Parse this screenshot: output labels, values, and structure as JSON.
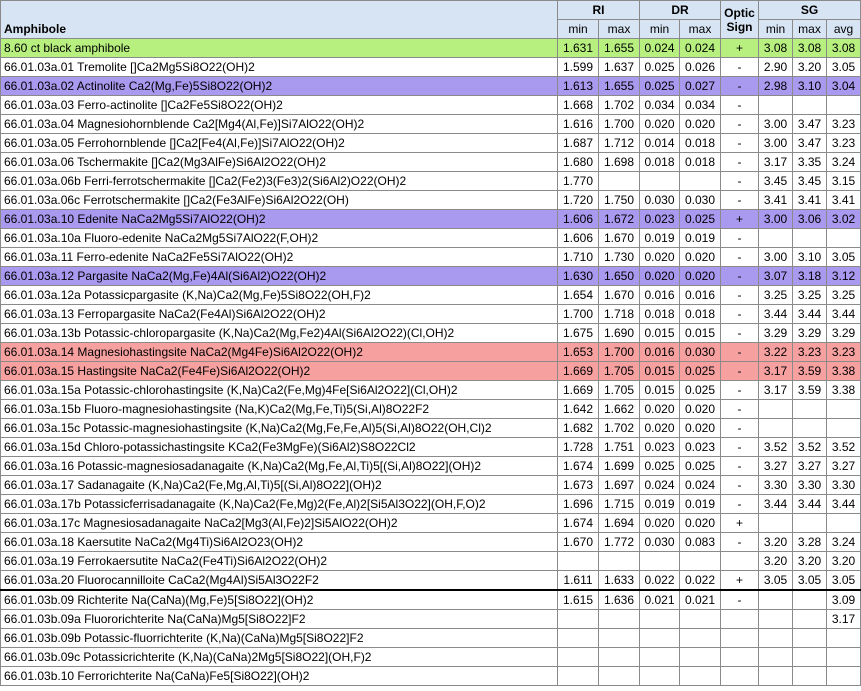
{
  "header": {
    "name_label": "Amphibole",
    "ri_label": "RI",
    "dr_label": "DR",
    "optic_sign_label": "Optic Sign",
    "sg_label": "SG",
    "min_label": "min",
    "max_label": "max",
    "avg_label": "avg"
  },
  "colors": {
    "header_bg": "#d7e4f3",
    "sample_highlight": "#b7f07f",
    "purple_highlight": "#a99af0",
    "red_highlight": "#f7a0a0"
  },
  "rows": [
    {
      "name": "8.60 ct black amphibole",
      "ri_min": "1.631",
      "ri_max": "1.655",
      "dr_min": "0.024",
      "dr_max": "0.024",
      "sign": "+",
      "sg_min": "3.08",
      "sg_max": "3.08",
      "sg_avg": "3.08",
      "hl": "sample"
    },
    {
      "name": "66.01.03a.01 Tremolite []Ca2Mg5Si8O22(OH)2",
      "ri_min": "1.599",
      "ri_max": "1.637",
      "dr_min": "0.025",
      "dr_max": "0.026",
      "sign": "-",
      "sg_min": "2.90",
      "sg_max": "3.20",
      "sg_avg": "3.05",
      "hl": ""
    },
    {
      "name": "66.01.03a.02 Actinolite Ca2(Mg,Fe)5Si8O22(OH)2",
      "ri_min": "1.613",
      "ri_max": "1.655",
      "dr_min": "0.025",
      "dr_max": "0.027",
      "sign": "-",
      "sg_min": "2.98",
      "sg_max": "3.10",
      "sg_avg": "3.04",
      "hl": "purple"
    },
    {
      "name": "66.01.03a.03 Ferro-actinolite []Ca2Fe5Si8O22(OH)2",
      "ri_min": "1.668",
      "ri_max": "1.702",
      "dr_min": "0.034",
      "dr_max": "0.034",
      "sign": "-",
      "sg_min": "",
      "sg_max": "",
      "sg_avg": "",
      "hl": ""
    },
    {
      "name": "66.01.03a.04 Magnesiohornblende Ca2[Mg4(Al,Fe)]Si7AlO22(OH)2",
      "ri_min": "1.616",
      "ri_max": "1.700",
      "dr_min": "0.020",
      "dr_max": "0.020",
      "sign": "-",
      "sg_min": "3.00",
      "sg_max": "3.47",
      "sg_avg": "3.23",
      "hl": ""
    },
    {
      "name": "66.01.03a.05 Ferrohornblende []Ca2[Fe4(Al,Fe)]Si7AlO22(OH)2",
      "ri_min": "1.687",
      "ri_max": "1.712",
      "dr_min": "0.014",
      "dr_max": "0.018",
      "sign": "-",
      "sg_min": "3.00",
      "sg_max": "3.47",
      "sg_avg": "3.23",
      "hl": ""
    },
    {
      "name": "66.01.03a.06 Tschermakite []Ca2(Mg3AlFe)Si6Al2O22(OH)2",
      "ri_min": "1.680",
      "ri_max": "1.698",
      "dr_min": "0.018",
      "dr_max": "0.018",
      "sign": "-",
      "sg_min": "3.17",
      "sg_max": "3.35",
      "sg_avg": "3.24",
      "hl": ""
    },
    {
      "name": "66.01.03a.06b Ferri-ferrotschermakite  []Ca2(Fe2)3(Fe3)2(Si6Al2)O22(OH)2",
      "ri_min": "1.770",
      "ri_max": "",
      "dr_min": "",
      "dr_max": "",
      "sign": "-",
      "sg_min": "3.45",
      "sg_max": "3.45",
      "sg_avg": "3.15",
      "hl": ""
    },
    {
      "name": "66.01.03a.06c Ferrotschermakite  []Ca2(Fe3AlFe)Si6Al2O22(OH)",
      "ri_min": "1.720",
      "ri_max": "1.750",
      "dr_min": "0.030",
      "dr_max": "0.030",
      "sign": "-",
      "sg_min": "3.41",
      "sg_max": "3.41",
      "sg_avg": "3.41",
      "hl": ""
    },
    {
      "name": "66.01.03a.10 Edenite NaCa2Mg5Si7AlO22(OH)2",
      "ri_min": "1.606",
      "ri_max": "1.672",
      "dr_min": "0.023",
      "dr_max": "0.025",
      "sign": "+",
      "sg_min": "3.00",
      "sg_max": "3.06",
      "sg_avg": "3.02",
      "hl": "purple"
    },
    {
      "name": "66.01.03a.10a Fluoro-edenite  NaCa2Mg5Si7AlO22(F,OH)2",
      "ri_min": "1.606",
      "ri_max": "1.670",
      "dr_min": "0.019",
      "dr_max": "0.019",
      "sign": "-",
      "sg_min": "",
      "sg_max": "",
      "sg_avg": "",
      "hl": ""
    },
    {
      "name": "66.01.03a.11 Ferro-edenite NaCa2Fe5Si7AlO22(OH)2",
      "ri_min": "1.710",
      "ri_max": "1.730",
      "dr_min": "0.020",
      "dr_max": "0.020",
      "sign": "-",
      "sg_min": "3.00",
      "sg_max": "3.10",
      "sg_avg": "3.05",
      "hl": ""
    },
    {
      "name": "66.01.03a.12 Pargasite NaCa2(Mg,Fe)4Al(Si6Al2)O22(OH)2",
      "ri_min": "1.630",
      "ri_max": "1.650",
      "dr_min": "0.020",
      "dr_max": "0.020",
      "sign": "-",
      "sg_min": "3.07",
      "sg_max": "3.18",
      "sg_avg": "3.12",
      "hl": "purple"
    },
    {
      "name": "66.01.03a.12a Potassicpargasite  (K,Na)Ca2(Mg,Fe)5Si8O22(OH,F)2",
      "ri_min": "1.654",
      "ri_max": "1.670",
      "dr_min": "0.016",
      "dr_max": "0.016",
      "sign": "-",
      "sg_min": "3.25",
      "sg_max": "3.25",
      "sg_avg": "3.25",
      "hl": ""
    },
    {
      "name": "66.01.03a.13 Ferropargasite NaCa2(Fe4Al)Si6Al2O22(OH)2",
      "ri_min": "1.700",
      "ri_max": "1.718",
      "dr_min": "0.018",
      "dr_max": "0.018",
      "sign": "-",
      "sg_min": "3.44",
      "sg_max": "3.44",
      "sg_avg": "3.44",
      "hl": ""
    },
    {
      "name": "66.01.03a.13b Potassic-chloropargasite  (K,Na)Ca2(Mg,Fe2)4Al(Si6Al2O22)(Cl,OH)2",
      "ri_min": "1.675",
      "ri_max": "1.690",
      "dr_min": "0.015",
      "dr_max": "0.015",
      "sign": "-",
      "sg_min": "3.29",
      "sg_max": "3.29",
      "sg_avg": "3.29",
      "hl": ""
    },
    {
      "name": "66.01.03a.14 Magnesiohastingsite NaCa2(Mg4Fe)Si6Al2O22(OH)2",
      "ri_min": "1.653",
      "ri_max": "1.700",
      "dr_min": "0.016",
      "dr_max": "0.030",
      "sign": "-",
      "sg_min": "3.22",
      "sg_max": "3.23",
      "sg_avg": "3.23",
      "hl": "red"
    },
    {
      "name": "66.01.03a.15 Hastingsite NaCa2(Fe4Fe)Si6Al2O22(OH)2",
      "ri_min": "1.669",
      "ri_max": "1.705",
      "dr_min": "0.015",
      "dr_max": "0.025",
      "sign": "-",
      "sg_min": "3.17",
      "sg_max": "3.59",
      "sg_avg": "3.38",
      "hl": "red"
    },
    {
      "name": "66.01.03a.15a Potassic-chlorohastingsite  (K,Na)Ca2(Fe,Mg)4Fe[Si6Al2O22](Cl,OH)2",
      "ri_min": "1.669",
      "ri_max": "1.705",
      "dr_min": "0.015",
      "dr_max": "0.025",
      "sign": "-",
      "sg_min": "3.17",
      "sg_max": "3.59",
      "sg_avg": "3.38",
      "hl": ""
    },
    {
      "name": "66.01.03a.15b Fluoro-magnesiohastingsite  (Na,K)Ca2(Mg,Fe,Ti)5(Si,Al)8O22F2",
      "ri_min": "1.642",
      "ri_max": "1.662",
      "dr_min": "0.020",
      "dr_max": "0.020",
      "sign": "-",
      "sg_min": "",
      "sg_max": "",
      "sg_avg": "",
      "hl": ""
    },
    {
      "name": "66.01.03a.15c Potassic-magnesiohastingsite  (K,Na)Ca2(Mg,Fe,Fe,Al)5(Si,Al)8O22(OH,Cl)2",
      "ri_min": "1.682",
      "ri_max": "1.702",
      "dr_min": "0.020",
      "dr_max": "0.020",
      "sign": "-",
      "sg_min": "",
      "sg_max": "",
      "sg_avg": "",
      "hl": ""
    },
    {
      "name": "66.01.03a.15d Chloro-potassichastingsite  KCa2(Fe3MgFe)(Si6Al2)S8O22Cl2",
      "ri_min": "1.728",
      "ri_max": "1.751",
      "dr_min": "0.023",
      "dr_max": "0.023",
      "sign": "-",
      "sg_min": "3.52",
      "sg_max": "3.52",
      "sg_avg": "3.52",
      "hl": ""
    },
    {
      "name": "66.01.03a.16 Potassic-magnesiosadanagaite  (K,Na)Ca2(Mg,Fe,Al,Ti)5[(Si,Al)8O22](OH)2",
      "ri_min": "1.674",
      "ri_max": "1.699",
      "dr_min": "0.025",
      "dr_max": "0.025",
      "sign": "-",
      "sg_min": "3.27",
      "sg_max": "3.27",
      "sg_avg": "3.27",
      "hl": ""
    },
    {
      "name": "66.01.03a.17 Sadanagaite  (K,Na)Ca2(Fe,Mg,Al,Ti)5[(Si,Al)8O22](OH)2",
      "ri_min": "1.673",
      "ri_max": "1.697",
      "dr_min": "0.024",
      "dr_max": "0.024",
      "sign": "-",
      "sg_min": "3.30",
      "sg_max": "3.30",
      "sg_avg": "3.30",
      "hl": ""
    },
    {
      "name": "66.01.03a.17b Potassicferrisadanagaite  (K,Na)Ca2(Fe,Mg)2(Fe,Al)2[Si5Al3O22](OH,F,O)2",
      "ri_min": "1.696",
      "ri_max": "1.715",
      "dr_min": "0.019",
      "dr_max": "0.019",
      "sign": "-",
      "sg_min": "3.44",
      "sg_max": "3.44",
      "sg_avg": "3.44",
      "hl": ""
    },
    {
      "name": "66.01.03a.17c Magnesiosadanagaite  NaCa2[Mg3(Al,Fe)2]Si5AlO22(OH)2",
      "ri_min": "1.674",
      "ri_max": "1.694",
      "dr_min": "0.020",
      "dr_max": "0.020",
      "sign": "+",
      "sg_min": "",
      "sg_max": "",
      "sg_avg": "",
      "hl": ""
    },
    {
      "name": "66.01.03a.18 Kaersutite NaCa2(Mg4Ti)Si6Al2O23(OH)2",
      "ri_min": "1.670",
      "ri_max": "1.772",
      "dr_min": "0.030",
      "dr_max": "0.083",
      "sign": "-",
      "sg_min": "3.20",
      "sg_max": "3.28",
      "sg_avg": "3.24",
      "hl": ""
    },
    {
      "name": "66.01.03a.19 Ferrokaersutite NaCa2(Fe4Ti)Si6Al2O22(OH)2",
      "ri_min": "",
      "ri_max": "",
      "dr_min": "",
      "dr_max": "",
      "sign": "",
      "sg_min": "3.20",
      "sg_max": "3.20",
      "sg_avg": "3.20",
      "hl": ""
    },
    {
      "name": "66.01.03a.20 Fluorocannilloite  CaCa2(Mg4Al)Si5Al3O22F2",
      "ri_min": "1.611",
      "ri_max": "1.633",
      "dr_min": "0.022",
      "dr_max": "0.022",
      "sign": "+",
      "sg_min": "3.05",
      "sg_max": "3.05",
      "sg_avg": "3.05",
      "hl": ""
    },
    {
      "name": "66.01.03b.09 Richterite Na(CaNa)(Mg,Fe)5[Si8O22](OH)2",
      "ri_min": "1.615",
      "ri_max": "1.636",
      "dr_min": "0.021",
      "dr_max": "0.021",
      "sign": "-",
      "sg_min": "",
      "sg_max": "",
      "sg_avg": "3.09",
      "hl": "",
      "sep": true
    },
    {
      "name": "66.01.03b.09a Fluororichterite Na(CaNa)Mg5[Si8O22]F2",
      "ri_min": "",
      "ri_max": "",
      "dr_min": "",
      "dr_max": "",
      "sign": "",
      "sg_min": "",
      "sg_max": "",
      "sg_avg": "3.17",
      "hl": ""
    },
    {
      "name": "66.01.03b.09b Potassic-fluorrichterite  (K,Na)(CaNa)Mg5[Si8O22]F2",
      "ri_min": "",
      "ri_max": "",
      "dr_min": "",
      "dr_max": "",
      "sign": "",
      "sg_min": "",
      "sg_max": "",
      "sg_avg": "",
      "hl": ""
    },
    {
      "name": "66.01.03b.09c Potassicrichterite  (K,Na)(CaNa)2Mg5[Si8O22](OH,F)2",
      "ri_min": "",
      "ri_max": "",
      "dr_min": "",
      "dr_max": "",
      "sign": "",
      "sg_min": "",
      "sg_max": "",
      "sg_avg": "",
      "hl": ""
    },
    {
      "name": "66.01.03b.10 Ferrorichterite Na(CaNa)Fe5[Si8O22](OH)2",
      "ri_min": "",
      "ri_max": "",
      "dr_min": "",
      "dr_max": "",
      "sign": "",
      "sg_min": "",
      "sg_max": "",
      "sg_avg": "",
      "hl": ""
    }
  ]
}
